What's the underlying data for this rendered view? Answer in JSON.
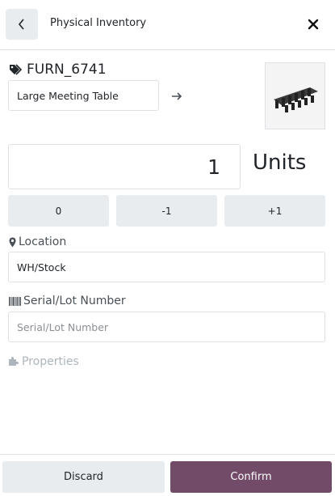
{
  "header": {
    "title": "Physical Inventory",
    "back_icon": "chevron-left-icon",
    "close_icon": "close-icon"
  },
  "product": {
    "code": "FURN_6741",
    "name": "Large Meeting Table",
    "tag_icon": "tags-icon",
    "link_icon": "arrow-right-icon",
    "image": "meeting-table-image"
  },
  "quantity": {
    "value": "1",
    "uom": "Units"
  },
  "quick_buttons": [
    {
      "label": "0"
    },
    {
      "label": "-1"
    },
    {
      "label": "+1"
    }
  ],
  "location": {
    "label": "Location",
    "value": "WH/Stock",
    "icon": "map-marker-icon"
  },
  "lot": {
    "label": "Serial/Lot Number",
    "placeholder": "Serial/Lot Number",
    "icon": "barcode-icon"
  },
  "properties": {
    "label": "Properties",
    "icon": "puzzle-icon"
  },
  "footer": {
    "discard_label": "Discard",
    "confirm_label": "Confirm"
  },
  "colors": {
    "accent": "#714b67",
    "button_bg": "#e9ecef",
    "border": "#dee2e6"
  }
}
